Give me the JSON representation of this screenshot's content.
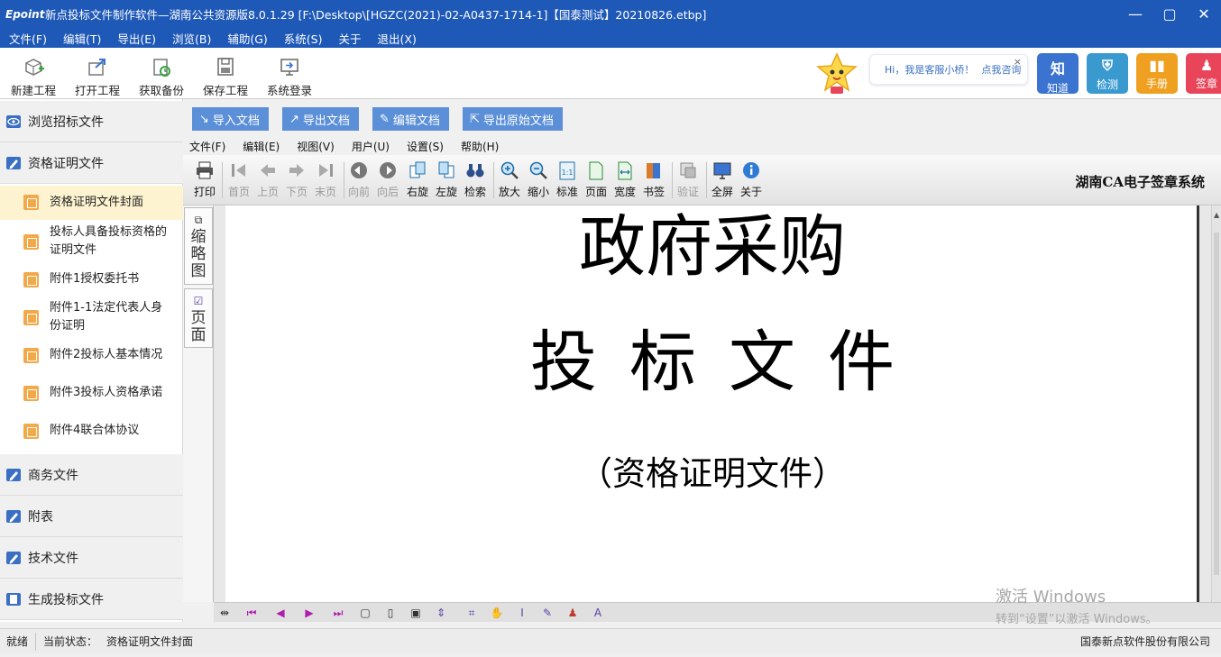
{
  "window": {
    "logo": "Epoint",
    "title": "新点投标文件制作软件—湖南公共资源版8.0.1.29     [F:\\Desktop\\[HGZC(2021)-02-A0437-1714-1]【国泰测试】20210826.etbp]",
    "controls": [
      "—",
      "▢",
      "✕"
    ]
  },
  "menu": [
    "文件(F)",
    "编辑(T)",
    "导出(E)",
    "浏览(B)",
    "辅助(G)",
    "系统(S)",
    "关于",
    "退出(X)"
  ],
  "toolbar": [
    {
      "label": "新建工程",
      "icon": "new-project-icon"
    },
    {
      "label": "打开工程",
      "icon": "open-project-icon"
    },
    {
      "label": "获取备份",
      "icon": "get-backup-icon"
    },
    {
      "label": "保存工程",
      "icon": "save-project-icon"
    },
    {
      "label": "系统登录",
      "icon": "login-icon"
    }
  ],
  "assistant_bubble": {
    "text": "Hi，我是客服小桥！",
    "link": "点我咨询",
    "close": "×"
  },
  "quick_buttons": [
    {
      "label": "知道",
      "glyph": "知",
      "color": "#3a73d0"
    },
    {
      "label": "检测",
      "glyph": "⛨",
      "color": "#3a9ad0"
    },
    {
      "label": "手册",
      "glyph": "▮▮",
      "color": "#f0a020"
    },
    {
      "label": "签章",
      "glyph": "♟",
      "color": "#e8445a"
    }
  ],
  "sidebar": {
    "sections_top": [
      {
        "label": "浏览招标文件",
        "icon": "eye-icon"
      },
      {
        "label": "资格证明文件",
        "icon": "edit-icon"
      }
    ],
    "items": [
      {
        "label": "资格证明文件封面",
        "active": true
      },
      {
        "label": "投标人具备投标资格的证明文件",
        "line1": "投标人具备投标资格的",
        "line2": "证明文件",
        "active": false
      },
      {
        "label": "附件1授权委托书",
        "active": false
      },
      {
        "label": "附件1-1法定代表人身份证明",
        "line1": "附件1-1法定代表人身",
        "line2": "份证明",
        "active": false
      },
      {
        "label": "附件2投标人基本情况",
        "active": false
      },
      {
        "label": "附件3投标人资格承诺",
        "active": false
      },
      {
        "label": "附件4联合体协议",
        "active": false
      }
    ],
    "sections_bottom": [
      {
        "label": "商务文件",
        "icon": "edit-icon"
      },
      {
        "label": "附表",
        "icon": "edit-icon"
      },
      {
        "label": "技术文件",
        "icon": "edit-icon"
      },
      {
        "label": "生成投标文件",
        "icon": "document-icon"
      }
    ]
  },
  "actions": [
    {
      "label": "导入文档",
      "icon": "↘"
    },
    {
      "label": "导出文档",
      "icon": "↗"
    },
    {
      "label": "编辑文档",
      "icon": "✎"
    },
    {
      "label": "导出原始文档",
      "icon": "⇱"
    }
  ],
  "inner_menu": [
    "文件(F)",
    "编辑(E)",
    "视图(V)",
    "用户(U)",
    "设置(S)",
    "帮助(H)"
  ],
  "inner_toolbar": [
    {
      "label": "打印",
      "disabled": false,
      "icon": "print-icon"
    },
    {
      "label": "首页",
      "disabled": true,
      "icon": "first-page-icon"
    },
    {
      "label": "上页",
      "disabled": true,
      "icon": "prev-page-icon"
    },
    {
      "label": "下页",
      "disabled": true,
      "icon": "next-page-icon"
    },
    {
      "label": "末页",
      "disabled": true,
      "icon": "last-page-icon"
    },
    {
      "label": "向前",
      "disabled": true,
      "icon": "back-icon"
    },
    {
      "label": "向后",
      "disabled": true,
      "icon": "forward-icon"
    },
    {
      "label": "右旋",
      "disabled": false,
      "icon": "rotate-right-icon"
    },
    {
      "label": "左旋",
      "disabled": false,
      "icon": "rotate-left-icon"
    },
    {
      "label": "检索",
      "disabled": false,
      "icon": "binoculars-icon"
    },
    {
      "label": "放大",
      "disabled": false,
      "icon": "zoom-in-icon"
    },
    {
      "label": "缩小",
      "disabled": false,
      "icon": "zoom-out-icon"
    },
    {
      "label": "标准",
      "disabled": false,
      "icon": "actual-size-icon"
    },
    {
      "label": "页面",
      "disabled": false,
      "icon": "fit-page-icon"
    },
    {
      "label": "宽度",
      "disabled": false,
      "icon": "fit-width-icon"
    },
    {
      "label": "书签",
      "disabled": false,
      "icon": "bookmark-icon"
    },
    {
      "label": "验证",
      "disabled": true,
      "icon": "verify-icon"
    },
    {
      "label": "全屏",
      "disabled": false,
      "icon": "fullscreen-icon"
    },
    {
      "label": "关于",
      "disabled": false,
      "icon": "info-icon"
    }
  ],
  "ca_title": "湖南CA电子签章系统",
  "side_tabs": [
    {
      "label": "缩略图",
      "chars": [
        "缩",
        "略",
        "图"
      ]
    },
    {
      "label": "页面",
      "chars": [
        "页",
        "面"
      ]
    }
  ],
  "document": {
    "line1": "政府采购",
    "line2": "投标文件",
    "line3": "（资格证明文件）"
  },
  "watermark": {
    "line1": "激活 Windows",
    "line2": "转到“设置”以激活 Windows。"
  },
  "status": {
    "ready": "就绪",
    "state_label": "当前状态：",
    "state_value": "资格证明文件封面",
    "company": "国泰新点软件股份有限公司"
  }
}
